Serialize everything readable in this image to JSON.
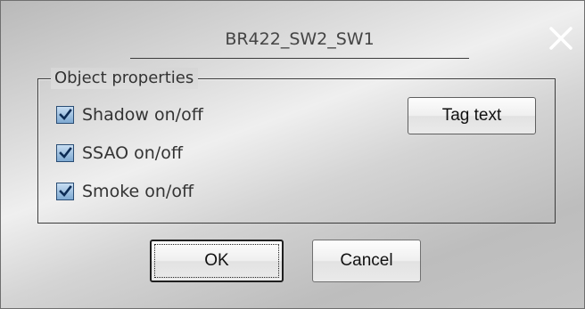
{
  "dialog": {
    "title": "BR422_SW2_SW1",
    "close_icon": "close-icon"
  },
  "group": {
    "legend": "Object properties",
    "checkboxes": [
      {
        "label": "Shadow on/off",
        "checked": true
      },
      {
        "label": "SSAO on/off",
        "checked": true
      },
      {
        "label": "Smoke on/off",
        "checked": true
      }
    ],
    "tag_button_label": "Tag text"
  },
  "buttons": {
    "ok_label": "OK",
    "cancel_label": "Cancel"
  },
  "colors": {
    "checkbox_fill": "#7ea9d2",
    "close_icon": "#ffffff"
  }
}
